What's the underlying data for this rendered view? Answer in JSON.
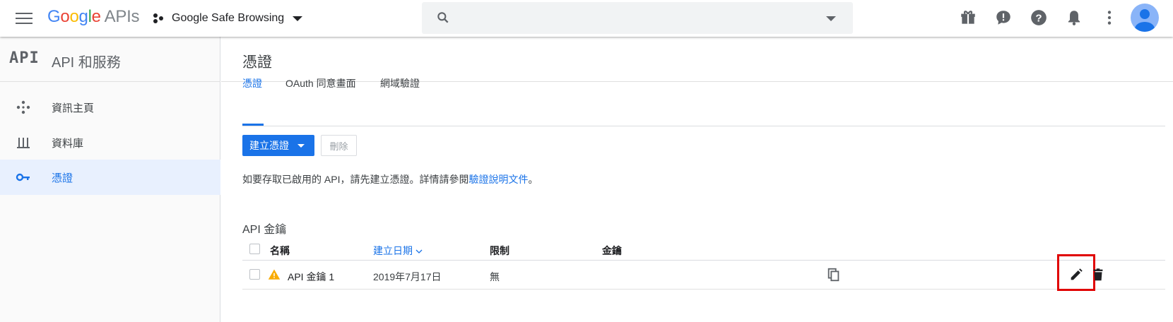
{
  "topbar": {
    "brand_letters": [
      "G",
      "o",
      "o",
      "g",
      "l",
      "e"
    ],
    "brand_suffix": "APIs",
    "project_name": "Google Safe Browsing",
    "search_placeholder": "",
    "icons": [
      "gift-icon",
      "feedback-icon",
      "help-icon",
      "notifications-icon",
      "more-vert-icon",
      "account-avatar"
    ]
  },
  "sidebar": {
    "logo": "API",
    "title": "API 和服務",
    "items": [
      {
        "label": "資訊主頁",
        "icon": "dashboard-icon",
        "active": false
      },
      {
        "label": "資料庫",
        "icon": "library-icon",
        "active": false
      },
      {
        "label": "憑證",
        "icon": "key-icon",
        "active": true
      }
    ]
  },
  "main": {
    "title": "憑證",
    "tabs": [
      {
        "label": "憑證",
        "active": true
      },
      {
        "label": "OAuth 同意畫面",
        "active": false
      },
      {
        "label": "網域驗證",
        "active": false
      }
    ],
    "create_button": "建立憑證",
    "delete_button": "刪除",
    "info_text": "如要存取已啟用的 API，請先建立憑證。詳情請參閱",
    "info_link": "驗證說明文件",
    "info_suffix": "。",
    "section_title": "API 金鑰",
    "table": {
      "headers": {
        "name": "名稱",
        "created": "建立日期",
        "restriction": "限制",
        "key": "金鑰"
      },
      "rows": [
        {
          "name": "API 金鑰 1",
          "created": "2019年7月17日",
          "restriction": "無",
          "key": ""
        }
      ]
    }
  },
  "colors": {
    "accent": "#1a73e8",
    "highlight_box": "#e00000",
    "warning": "#f9ab00"
  }
}
